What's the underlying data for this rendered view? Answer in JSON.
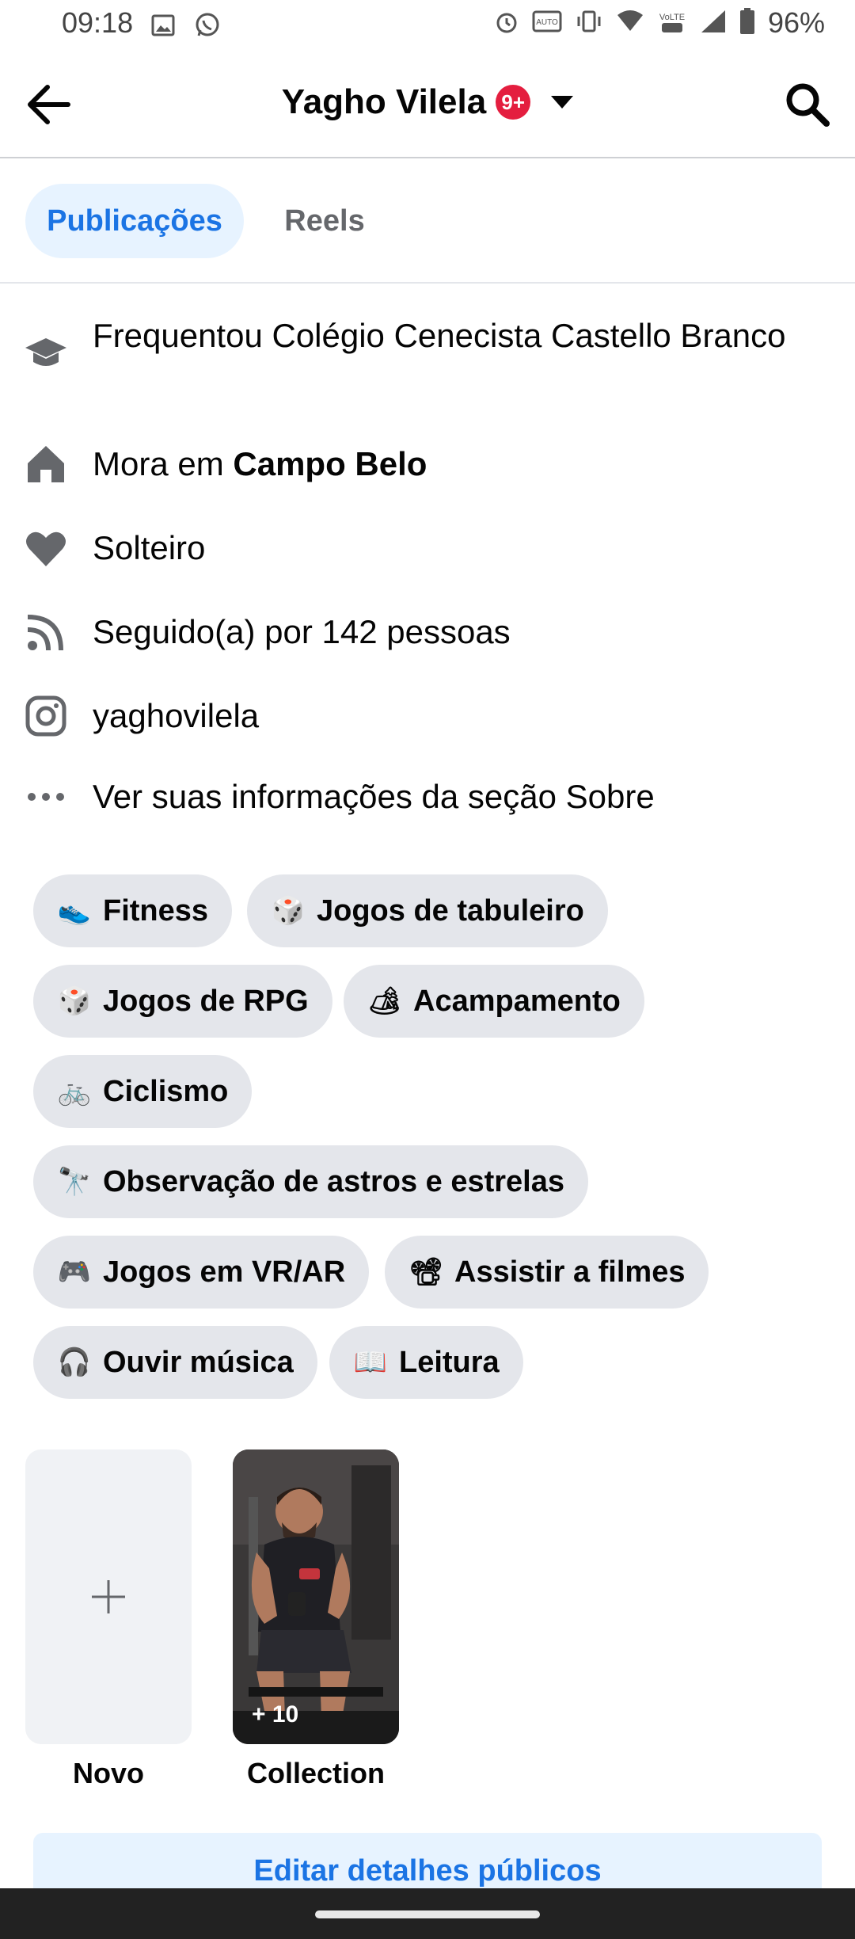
{
  "status_bar": {
    "time": "09:18",
    "battery_percent": "96%",
    "icons_left": [
      "image-icon",
      "whatsapp-icon"
    ],
    "icons_right": [
      "alarm-icon",
      "auto-hd-icon",
      "vibrate-icon",
      "wifi-icon",
      "volte-icon",
      "signal-icon",
      "battery-icon"
    ]
  },
  "header": {
    "title": "Yagho Vilela",
    "badge": "9+",
    "badge_color": "#e41e3f"
  },
  "tabs": [
    {
      "label": "Publicações",
      "active": true
    },
    {
      "label": "Reels",
      "active": false
    }
  ],
  "info": {
    "education": "Frequentou Colégio Cenecista Castello Branco",
    "lives_prefix": "Mora em ",
    "lives_place": "Campo Belo",
    "relationship": "Solteiro",
    "followers": "Seguido(a) por 142 pessoas",
    "instagram": "yaghovilela",
    "see_about": "Ver suas informações da seção Sobre"
  },
  "interests": [
    {
      "label": "Fitness",
      "icon": "running-shoe-icon",
      "emoji": "👟"
    },
    {
      "label": "Jogos de tabuleiro",
      "icon": "dice-icon",
      "emoji": "🎲"
    },
    {
      "label": "Jogos de RPG",
      "icon": "dice-icon",
      "emoji": "🎲"
    },
    {
      "label": "Acampamento",
      "icon": "camping-icon",
      "emoji": "🏕"
    },
    {
      "label": "Ciclismo",
      "icon": "bicycle-icon",
      "emoji": "🚲"
    },
    {
      "label": "Observação de astros e estrelas",
      "icon": "telescope-icon",
      "emoji": "🔭"
    },
    {
      "label": "Jogos em VR/AR",
      "icon": "gamepad-icon",
      "emoji": "🎮"
    },
    {
      "label": "Assistir a filmes",
      "icon": "film-projector-icon",
      "emoji": "📽"
    },
    {
      "label": "Ouvir música",
      "icon": "headphones-icon",
      "emoji": "🎧"
    },
    {
      "label": "Leitura",
      "icon": "book-icon",
      "emoji": "📖"
    }
  ],
  "collections": {
    "new_label": "Novo",
    "photo_label": "Collection",
    "photo_count": "+ 10"
  },
  "edit_button": "Editar detalhes públicos",
  "colors": {
    "accent": "#1b74e4",
    "accent_bg": "#e7f3ff",
    "chip_bg": "#e4e6eb",
    "icon_gray": "#65676b"
  }
}
